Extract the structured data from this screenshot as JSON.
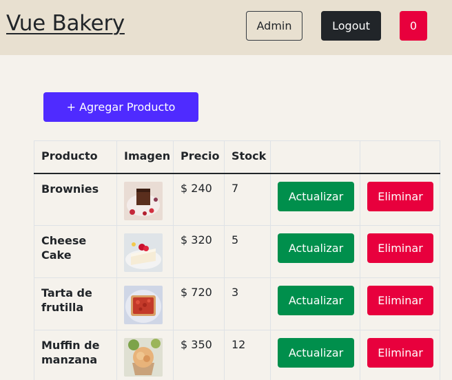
{
  "header": {
    "brand": "Vue Bakery",
    "admin_label": "Admin",
    "logout_label": "Logout",
    "cart_count": "0"
  },
  "add_button_label": "+ Agregar Producto",
  "table": {
    "headers": [
      "Producto",
      "Imagen",
      "Precio",
      "Stock",
      "",
      ""
    ],
    "rows": [
      {
        "name": "Brownies",
        "price": "$ 240",
        "stock": "7",
        "update_label": "Actualizar",
        "delete_label": "Eliminar"
      },
      {
        "name": "Cheese Cake",
        "price": "$ 320",
        "stock": "5",
        "update_label": "Actualizar",
        "delete_label": "Eliminar"
      },
      {
        "name": "Tarta de frutilla",
        "price": "$ 720",
        "stock": "3",
        "update_label": "Actualizar",
        "delete_label": "Eliminar"
      },
      {
        "name": "Muffin de manzana",
        "price": "$ 350",
        "stock": "12",
        "update_label": "Actualizar",
        "delete_label": "Eliminar"
      }
    ]
  },
  "colors": {
    "header_bg": "#e8e0d0",
    "page_bg": "#f5f2ec",
    "primary": "#4f2bff",
    "success": "#008f4c",
    "danger": "#e8003d",
    "dark": "#212529"
  }
}
